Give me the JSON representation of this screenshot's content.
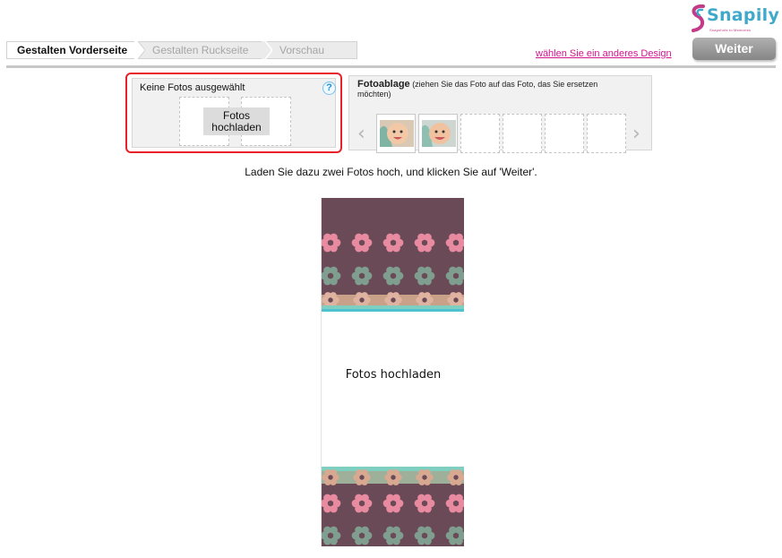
{
  "brand": {
    "name": "Snapily",
    "tagline": "Snapshots to Memories",
    "color_primary": "#3fa9c9",
    "color_accent": "#c33b88"
  },
  "steps": [
    {
      "label": "Gestalten Vorderseite",
      "active": true
    },
    {
      "label": "Gestalten Ruckseite",
      "active": false
    },
    {
      "label": "Vorschau",
      "active": false
    }
  ],
  "header": {
    "design_link": "wählen Sie ein anderes Design",
    "next_button": "Weiter"
  },
  "selection": {
    "status": "Keine Fotos ausgewählt",
    "help": "?",
    "upload_button": "Fotos hochladen",
    "highlight_color": "#e8202a"
  },
  "tray": {
    "title": "Fotoablage",
    "hint": "(ziehen Sie das Foto auf das Foto, das Sie ersetzen möchten)",
    "prev_icon": "chevron-left-icon",
    "next_icon": "chevron-right-icon",
    "thumbnails": [
      {
        "filled": true,
        "icon": "baby-photo"
      },
      {
        "filled": true,
        "icon": "baby-photo"
      },
      {
        "filled": false
      },
      {
        "filled": false
      },
      {
        "filled": false
      },
      {
        "filled": false
      }
    ]
  },
  "instructions": "Laden Sie dazu zwei Fotos hoch, und klicken Sie auf 'Weiter'.",
  "card": {
    "placeholder": "Fotos hochladen",
    "pattern_background": "#6b4a58",
    "flower_colors": [
      "#e88aa0",
      "#7f9e8f"
    ]
  }
}
